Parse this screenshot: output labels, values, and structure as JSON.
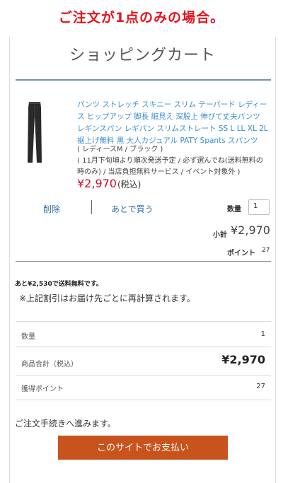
{
  "banner": "ご注文が1点のみの場合。",
  "cart": {
    "title": "ショッピングカート"
  },
  "item": {
    "name": "パンツ ストレッチ スキニー スリム テーパード レディース ヒップアップ 脚長 細見え 深股上 伸びて丈夫パンツ レギンスパン レギパン スリムストレート SS L LL XL 2L 裾上げ無料 黒 大人カジュアル PATY Spants スパンツ",
    "variation": "( レディースM / ブラック )",
    "shipping_note": "( 11月下旬頃より順次発送予定 / 必ず選んでね(送料無料の時のみ) / 当店負担無料サービス / イベント対象外 )",
    "price": "¥2,970",
    "price_tax_label": "(税込)",
    "delete_label": "削除",
    "later_label": "あとで買う",
    "quantity_label": "数量",
    "quantity_value": "1",
    "subtotal_label": "小計",
    "subtotal_value": "¥2,970",
    "points_label": "ポイント",
    "points_value": "27"
  },
  "free_shipping_note": "あと¥2,530で送料無料です。",
  "recalc_note": "※上記割引はお届け先ごとに再計算されます。",
  "summary": {
    "quantity_label": "数量",
    "quantity_value": "1",
    "total_label": "商品合計（税込）",
    "total_value": "¥2,970",
    "points_label": "獲得ポイント",
    "points_value": "27"
  },
  "proceed_text": "ご注文手続きへ進みます。",
  "pay_button": "このサイトでお支払い",
  "colors": {
    "banner": "#e8121c",
    "link": "#3b8fd0",
    "price": "#c8102e",
    "pay_button": "#c9531c"
  }
}
